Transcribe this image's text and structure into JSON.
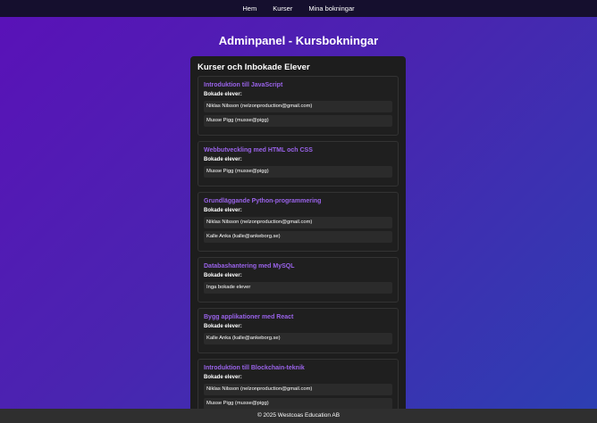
{
  "nav": {
    "items": [
      {
        "label": "Hem"
      },
      {
        "label": "Kurser"
      },
      {
        "label": "Mina bokningar"
      }
    ]
  },
  "page": {
    "title": "Adminpanel - Kursbokningar"
  },
  "panel": {
    "title": "Kurser och Inbokade Elever",
    "booked_label": "Bokade elever:"
  },
  "courses": [
    {
      "name": "Introduktion till JavaScript",
      "students": [
        "Niklas Nilsson (nelzonproduction@gmail.com)",
        "Musse Pigg (musse@pigg)"
      ]
    },
    {
      "name": "Webbutveckling med HTML och CSS",
      "students": [
        "Musse Pigg (musse@pigg)"
      ]
    },
    {
      "name": "Grundläggande Python-programmering",
      "students": [
        "Niklas Nilsson (nelzonproduction@gmail.com)",
        "Kalle Anka (kalle@ankeborg.se)"
      ]
    },
    {
      "name": "Databashantering med MySQL",
      "students": [
        "Inga bokade elever"
      ]
    },
    {
      "name": "Bygg applikationer med React",
      "students": [
        "Kalle Anka (kalle@ankeborg.se)"
      ]
    },
    {
      "name": "Introduktion till Blockchain-teknik",
      "students": [
        "Niklas Nilsson (nelzonproduction@gmail.com)",
        "Musse Pigg (musse@pigg)"
      ]
    }
  ],
  "footer": {
    "text": "© 2025 Westcoas Education AB"
  }
}
